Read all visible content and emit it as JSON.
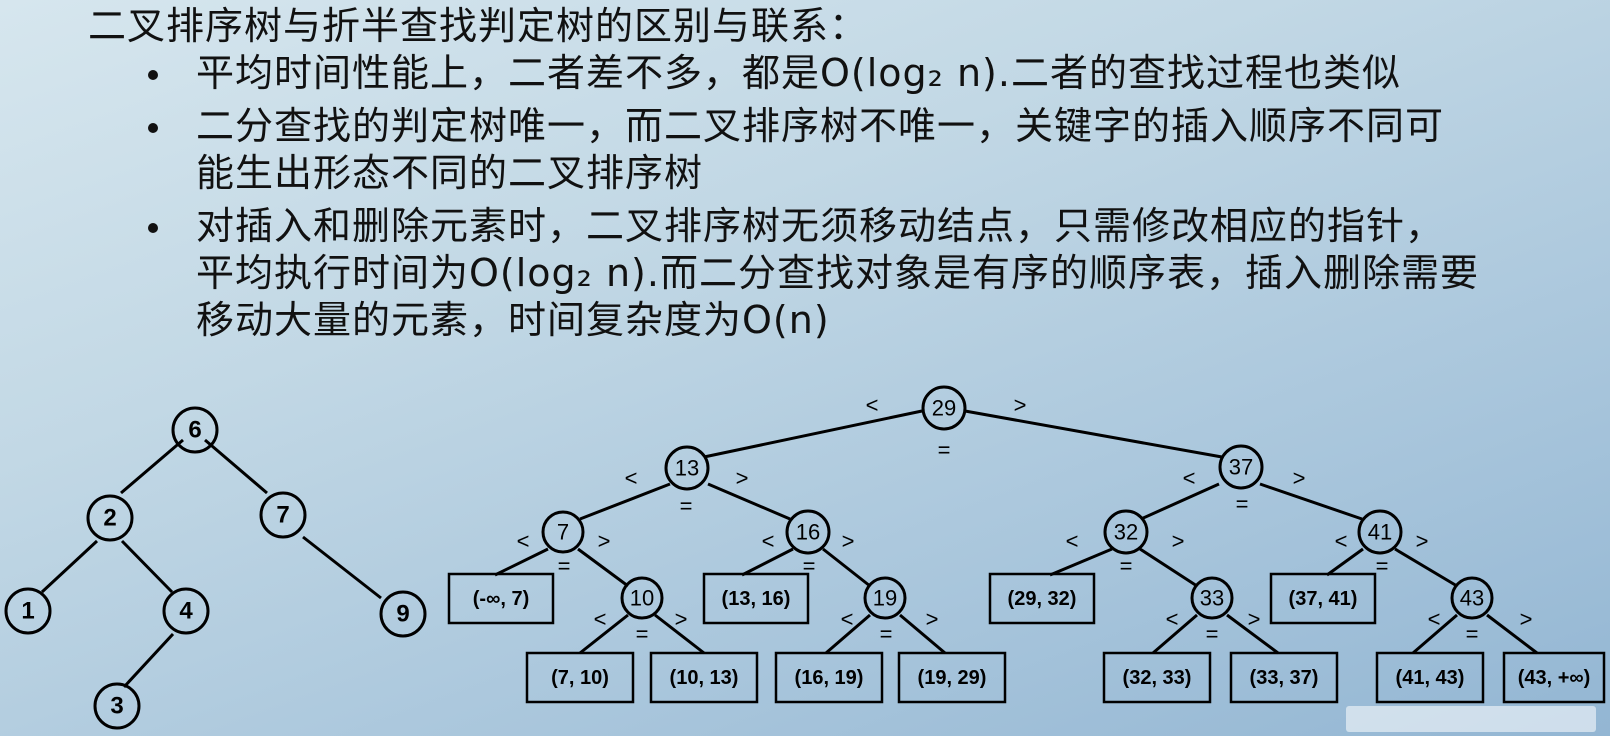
{
  "title": "二叉排序树与折半查找判定树的区别与联系：",
  "bullets": [
    {
      "lines": [
        "平均时间性能上，二者差不多，都是O(log₂ n).二者的查找过程也类似"
      ]
    },
    {
      "lines": [
        "二分查找的判定树唯一，而二叉排序树不唯一，关键字的插入顺序不同可",
        "能生出形态不同的二叉排序树"
      ]
    },
    {
      "lines": [
        "对插入和删除元素时，二叉排序树无须移动结点，只需修改相应的指针，",
        "平均执行时间为O(log₂ n).而二分查找对象是有序的顺序表，插入删除需要",
        "移动大量的元素，时间复杂度为O(n)"
      ]
    }
  ],
  "bst_tree": {
    "nodes": [
      {
        "id": "n6",
        "label": "6"
      },
      {
        "id": "n2",
        "label": "2"
      },
      {
        "id": "n7",
        "label": "7"
      },
      {
        "id": "n1",
        "label": "1"
      },
      {
        "id": "n4",
        "label": "4"
      },
      {
        "id": "n9",
        "label": "9"
      },
      {
        "id": "n3",
        "label": "3"
      }
    ],
    "edges": [
      [
        "n6",
        "n2"
      ],
      [
        "n6",
        "n7"
      ],
      [
        "n2",
        "n1"
      ],
      [
        "n2",
        "n4"
      ],
      [
        "n4",
        "n3"
      ],
      [
        "n7",
        "n9"
      ]
    ]
  },
  "decision_tree": {
    "symbols": {
      "lt": "<",
      "gt": ">",
      "eq": "="
    },
    "nodes": [
      {
        "id": "d29",
        "label": "29"
      },
      {
        "id": "d13",
        "label": "13"
      },
      {
        "id": "d37",
        "label": "37"
      },
      {
        "id": "d7",
        "label": "7"
      },
      {
        "id": "d16",
        "label": "16"
      },
      {
        "id": "d32",
        "label": "32"
      },
      {
        "id": "d41",
        "label": "41"
      },
      {
        "id": "d10",
        "label": "10"
      },
      {
        "id": "d19",
        "label": "19"
      },
      {
        "id": "d33",
        "label": "33"
      },
      {
        "id": "d43",
        "label": "43"
      }
    ],
    "leaves": [
      {
        "id": "l1",
        "label": "(-∞, 7)"
      },
      {
        "id": "l2",
        "label": "(7, 10)"
      },
      {
        "id": "l3",
        "label": "(10, 13)"
      },
      {
        "id": "l4",
        "label": "(13, 16)"
      },
      {
        "id": "l5",
        "label": "(16, 19)"
      },
      {
        "id": "l6",
        "label": "(19, 29)"
      },
      {
        "id": "l7",
        "label": "(29, 32)"
      },
      {
        "id": "l8",
        "label": "(32, 33)"
      },
      {
        "id": "l9",
        "label": "(33, 37)"
      },
      {
        "id": "l10",
        "label": "(37, 41)"
      },
      {
        "id": "l11",
        "label": "(41, 43)"
      },
      {
        "id": "l12",
        "label": "(43, +∞)"
      }
    ],
    "edges": [
      [
        "d29",
        "d13"
      ],
      [
        "d29",
        "d37"
      ],
      [
        "d13",
        "d7"
      ],
      [
        "d13",
        "d16"
      ],
      [
        "d37",
        "d32"
      ],
      [
        "d37",
        "d41"
      ],
      [
        "d7",
        "l1"
      ],
      [
        "d7",
        "d10"
      ],
      [
        "d10",
        "l2"
      ],
      [
        "d10",
        "l3"
      ],
      [
        "d16",
        "l4"
      ],
      [
        "d16",
        "d19"
      ],
      [
        "d19",
        "l5"
      ],
      [
        "d19",
        "l6"
      ],
      [
        "d32",
        "l7"
      ],
      [
        "d32",
        "d33"
      ],
      [
        "d33",
        "l8"
      ],
      [
        "d33",
        "l9"
      ],
      [
        "d41",
        "l10"
      ],
      [
        "d41",
        "d43"
      ],
      [
        "d43",
        "l11"
      ],
      [
        "d43",
        "l12"
      ]
    ]
  }
}
